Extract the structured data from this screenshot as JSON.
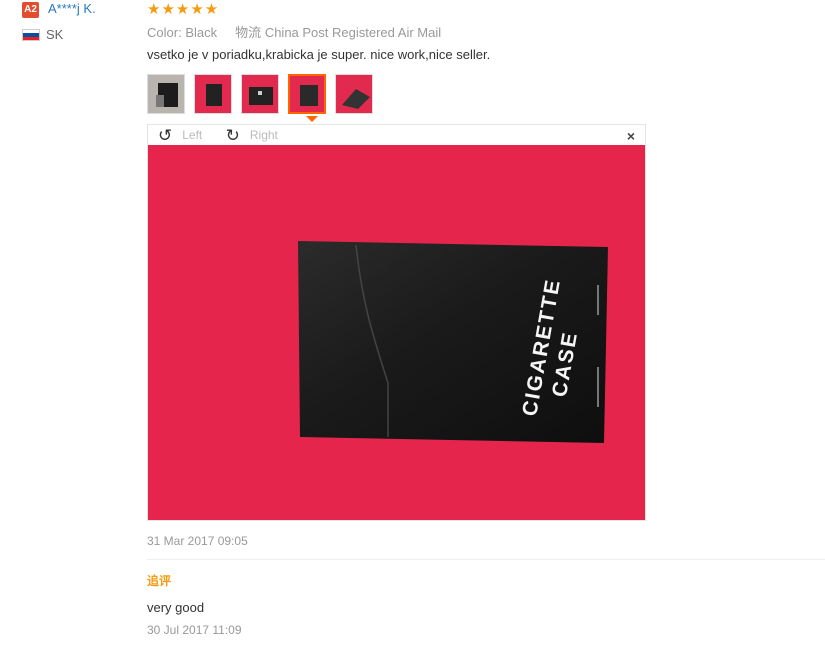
{
  "reviewer": {
    "level_badge": "A2",
    "name": "A****j K.",
    "country_code": "SK"
  },
  "review": {
    "stars": "★★★★★",
    "rating": 5,
    "color_label": "Color:",
    "color_value": "Black",
    "shipping_label": "物流",
    "shipping_value": "China Post Registered Air Mail",
    "text": "vsetko je v poriadku,krabicka je super. nice work,nice seller.",
    "date": "31 Mar 2017 09:05"
  },
  "viewer": {
    "rotate_left_label": "Left",
    "rotate_right_label": "Right",
    "close_icon": "×",
    "photo_text_line1": "CIGARETTE",
    "photo_text_line2": "CASE"
  },
  "followup": {
    "label": "追评",
    "text": "very good",
    "date": "30 Jul 2017 11:09"
  },
  "colors": {
    "accent": "#f39c12",
    "link": "#2a7ac0",
    "photo_bg": "#e8234a"
  }
}
